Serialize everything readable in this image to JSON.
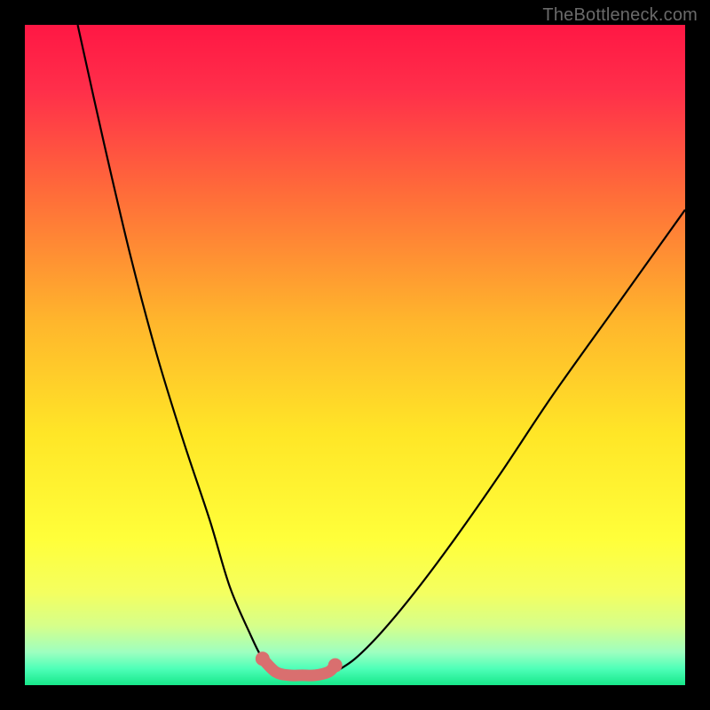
{
  "attribution": "TheBottleneck.com",
  "colors": {
    "black": "#000000",
    "curve": "#000000",
    "marker": "#d96f6f",
    "gradient_stops": [
      {
        "pos": 0.0,
        "color": "#ff1744"
      },
      {
        "pos": 0.1,
        "color": "#ff2f4a"
      },
      {
        "pos": 0.25,
        "color": "#ff6a3a"
      },
      {
        "pos": 0.45,
        "color": "#ffb62c"
      },
      {
        "pos": 0.62,
        "color": "#ffe627"
      },
      {
        "pos": 0.78,
        "color": "#ffff3a"
      },
      {
        "pos": 0.86,
        "color": "#f4ff60"
      },
      {
        "pos": 0.91,
        "color": "#d6ff8a"
      },
      {
        "pos": 0.95,
        "color": "#9effc0"
      },
      {
        "pos": 0.975,
        "color": "#4effb8"
      },
      {
        "pos": 1.0,
        "color": "#17e88a"
      }
    ]
  },
  "chart_data": {
    "type": "line",
    "title": "",
    "xlabel": "",
    "ylabel": "",
    "xlim": [
      0,
      100
    ],
    "ylim": [
      0,
      100
    ],
    "grid": false,
    "legend": false,
    "series": [
      {
        "name": "left-branch",
        "x": [
          8,
          12,
          16,
          20,
          24,
          28,
          31,
          34,
          36,
          38
        ],
        "values": [
          100,
          82,
          65,
          50,
          37,
          25,
          15,
          8,
          4,
          2
        ]
      },
      {
        "name": "right-branch",
        "x": [
          47,
          50,
          54,
          59,
          65,
          72,
          80,
          90,
          100
        ],
        "values": [
          2,
          4,
          8,
          14,
          22,
          32,
          44,
          58,
          72
        ]
      },
      {
        "name": "valley-highlight",
        "x": [
          36,
          38,
          40,
          42,
          44,
          46,
          47
        ],
        "values": [
          4,
          2,
          1.5,
          1.5,
          1.5,
          2,
          3
        ]
      }
    ],
    "annotations": []
  }
}
